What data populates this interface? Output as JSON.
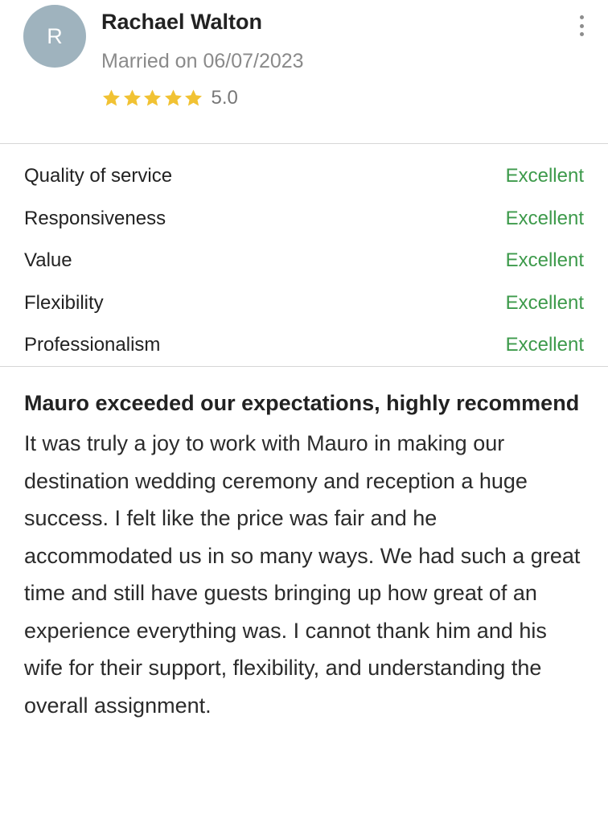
{
  "reviewer": {
    "initial": "R",
    "name": "Rachael Walton",
    "married_text": "Married on 06/07/2023",
    "rating": "5.0",
    "stars": 5,
    "star_color": "#f1c233",
    "avatar_color": "#9fb3be"
  },
  "menu_icon": "more-vertical-icon",
  "scores": [
    {
      "label": "Quality of service",
      "value": "Excellent"
    },
    {
      "label": "Responsiveness",
      "value": "Excellent"
    },
    {
      "label": "Value",
      "value": "Excellent"
    },
    {
      "label": "Flexibility",
      "value": "Excellent"
    },
    {
      "label": "Professionalism",
      "value": "Excellent"
    }
  ],
  "score_color": "#3d9a4b",
  "review": {
    "title": "Mauro exceeded our expectations, highly recommend",
    "body": "It was truly a joy to work with Mauro in making our destination wedding ceremony and reception a huge success. I felt like the price was fair and he accommodated us in so many ways. We had such a great time and still have guests bringing up how great of an experience everything was. I cannot thank him and his wife for their support, flexibility, and understanding the overall assignment."
  }
}
